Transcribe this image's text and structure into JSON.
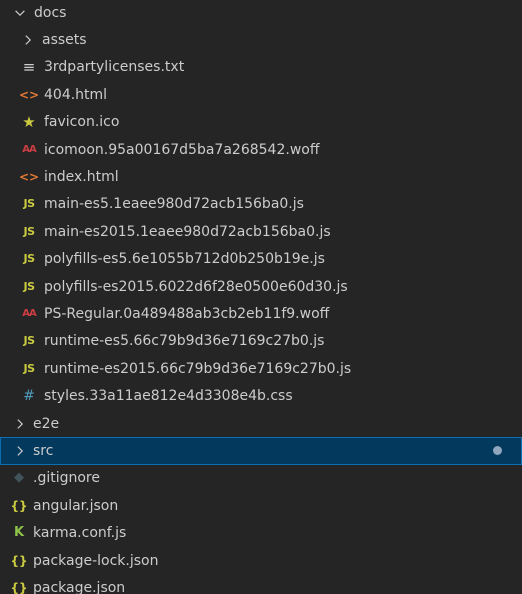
{
  "explorer": {
    "docs_folder": {
      "label": "docs",
      "state": "expanded"
    },
    "docs_items": [
      {
        "kind": "folder",
        "label": "assets",
        "icon": "chevron-right-icon"
      },
      {
        "kind": "file",
        "label": "3rdpartylicenses.txt",
        "icon": "text-file-icon",
        "glyph": "≡"
      },
      {
        "kind": "file",
        "label": "404.html",
        "icon": "html-file-icon",
        "glyph": "<>"
      },
      {
        "kind": "file",
        "label": "favicon.ico",
        "icon": "star-icon",
        "glyph": "★"
      },
      {
        "kind": "file",
        "label": "icomoon.95a00167d5ba7a268542.woff",
        "icon": "font-file-icon",
        "glyph": "AA"
      },
      {
        "kind": "file",
        "label": "index.html",
        "icon": "html-file-icon",
        "glyph": "<>"
      },
      {
        "kind": "file",
        "label": "main-es5.1eaee980d72acb156ba0.js",
        "icon": "js-file-icon",
        "glyph": "JS"
      },
      {
        "kind": "file",
        "label": "main-es2015.1eaee980d72acb156ba0.js",
        "icon": "js-file-icon",
        "glyph": "JS"
      },
      {
        "kind": "file",
        "label": "polyfills-es5.6e1055b712d0b250b19e.js",
        "icon": "js-file-icon",
        "glyph": "JS"
      },
      {
        "kind": "file",
        "label": "polyfills-es2015.6022d6f28e0500e60d30.js",
        "icon": "js-file-icon",
        "glyph": "JS"
      },
      {
        "kind": "file",
        "label": "PS-Regular.0a489488ab3cb2eb11f9.woff",
        "icon": "font-file-icon",
        "glyph": "AA"
      },
      {
        "kind": "file",
        "label": "runtime-es5.66c79b9d36e7169c27b0.js",
        "icon": "js-file-icon",
        "glyph": "JS"
      },
      {
        "kind": "file",
        "label": "runtime-es2015.66c79b9d36e7169c27b0.js",
        "icon": "js-file-icon",
        "glyph": "JS"
      },
      {
        "kind": "file",
        "label": "styles.33a11ae812e4d3308e4b.css",
        "icon": "css-file-icon",
        "glyph": "#"
      }
    ],
    "root_items": [
      {
        "kind": "folder",
        "label": "e2e",
        "icon": "chevron-right-icon"
      },
      {
        "kind": "folder",
        "label": "src",
        "icon": "chevron-right-icon",
        "selected": true,
        "modified": true
      },
      {
        "kind": "file",
        "label": ".gitignore",
        "icon": "git-file-icon",
        "glyph": "◆"
      },
      {
        "kind": "file",
        "label": "angular.json",
        "icon": "json-file-icon",
        "glyph": "{}"
      },
      {
        "kind": "file",
        "label": "karma.conf.js",
        "icon": "karma-file-icon",
        "glyph": "K"
      },
      {
        "kind": "file",
        "label": "package-lock.json",
        "icon": "json-file-icon",
        "glyph": "{}"
      },
      {
        "kind": "file",
        "label": "package.json",
        "icon": "json-file-icon",
        "glyph": "{}"
      }
    ],
    "colors": {
      "background": "#252526",
      "selected_background": "#04395e",
      "selected_border": "#0d6fb3",
      "text": "#cccccc",
      "modified_dot": "#8fa6bd"
    }
  }
}
